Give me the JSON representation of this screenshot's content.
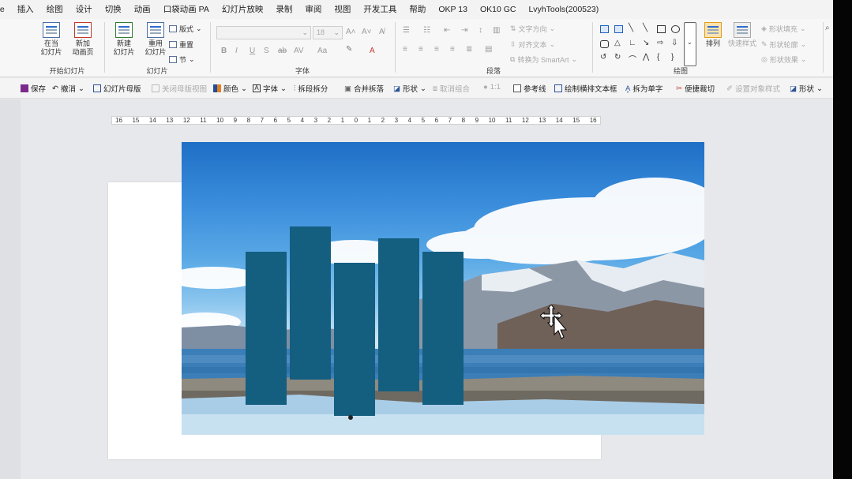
{
  "menu": {
    "tabs": [
      "de",
      "插入",
      "绘图",
      "设计",
      "切换",
      "动画",
      "口袋动画 PA",
      "幻灯片放映",
      "录制",
      "审阅",
      "视图",
      "开发工具",
      "帮助",
      "OKP 13",
      "OK10 GC",
      "LvyhTools(200523)"
    ]
  },
  "ribbon": {
    "from_current": "在当\n幻灯片",
    "new_layout": "新加\n动画页",
    "new_slide": "新建\n幻灯片",
    "reuse_slide": "重用\n幻灯片",
    "layout": "版式",
    "reset": "重置",
    "section": "节",
    "font_size": "18",
    "text_direction": "文字方向",
    "align_text": "对齐文本",
    "convert_smartart": "转换为 SmartArt",
    "arrange": "排列",
    "quick_styles": "快速样式",
    "shape_fill": "形状填充",
    "shape_outline": "形状轮廓",
    "shape_effects": "形状效果",
    "groups": {
      "slideshow": "开始幻灯片",
      "slides": "幻灯片",
      "font": "字体",
      "paragraph": "段落",
      "drawing": "绘图"
    }
  },
  "quickbar": {
    "save": "保存",
    "undo": "撤消",
    "slide_master": "幻灯片母版",
    "close_master": "关闭母版视图",
    "color": "颜色",
    "font": "字体",
    "split": "拆段拆分",
    "merge_split": "合并拆落",
    "shape": "形状",
    "ungroup": "取消组合",
    "ratio": "1:1",
    "guides": "参考线",
    "draw_textbox": "绘制横排文本框",
    "split_chars": "拆为单字",
    "quick_cut": "便捷裁切",
    "set_object": "设置对象样式",
    "shape2": "形状"
  },
  "ruler": {
    "ticks": [
      "16",
      "15",
      "14",
      "13",
      "12",
      "11",
      "10",
      "9",
      "8",
      "7",
      "6",
      "5",
      "4",
      "3",
      "2",
      "1",
      "0",
      "1",
      "2",
      "3",
      "4",
      "5",
      "6",
      "7",
      "8",
      "9",
      "10",
      "11",
      "12",
      "13",
      "14",
      "15",
      "16"
    ]
  },
  "slide_shapes": {
    "bar_color": "#145e80",
    "bar_count": 5
  },
  "colors": {
    "workspace": "#e7e8eb",
    "ribbon": "#f7f7f7",
    "accent": "#1f5fbf"
  }
}
